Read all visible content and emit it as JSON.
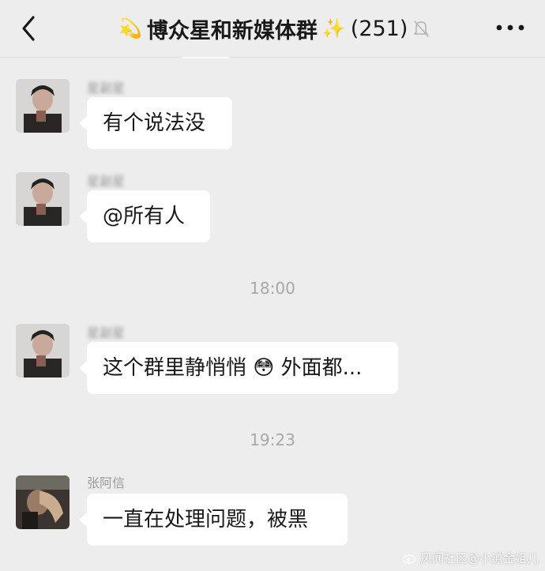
{
  "header": {
    "back_icon": "chevron-left-icon",
    "title_prefix_emoji": "💫",
    "title": "博众星和新媒体群",
    "title_suffix_emoji": "✨",
    "member_count": "(251)",
    "mute_icon": "bell-off-icon",
    "more_icon": "more-dots-icon"
  },
  "messages": [
    {
      "sender": "星副星",
      "text": "有个说法没"
    },
    {
      "sender": "星副星",
      "text": "@所有人"
    },
    {
      "sender": "星副星",
      "text": "这个群里静悄悄",
      "emoji": "😳",
      "text_after": "外面都..."
    },
    {
      "sender": "张阿信",
      "text": "一直在处理问题，被黑"
    }
  ],
  "timestamps": [
    "18:00",
    "19:23"
  ],
  "watermark": {
    "text": "风闻社区@小道金姐儿",
    "logo_icon": "weibo-icon"
  },
  "colors": {
    "background": "#ededed",
    "bubble": "#ffffff",
    "timestamp": "#a8a8a8"
  }
}
